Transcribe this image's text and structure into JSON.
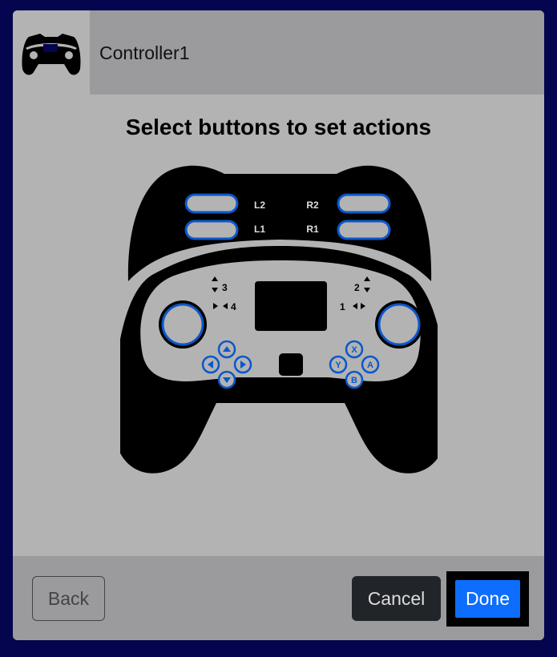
{
  "header": {
    "title": "Controller1",
    "icon": "gamepad-icon"
  },
  "instruction": "Select buttons to set actions",
  "controller": {
    "shoulder_labels": {
      "l2": "L2",
      "r2": "R2",
      "l1": "L1",
      "r1": "R1"
    },
    "axis_labels": {
      "left_vertical": "3",
      "left_horizontal": "4",
      "right_vertical": "2",
      "right_horizontal": "1"
    },
    "face_buttons": {
      "x": "X",
      "y": "Y",
      "a": "A",
      "b": "B"
    },
    "colors": {
      "body": "#000000",
      "panel": "#b3b3b3",
      "button_fill": "#b3b3b3",
      "button_stroke": "#0b57c9"
    }
  },
  "footer": {
    "back_label": "Back",
    "cancel_label": "Cancel",
    "done_label": "Done"
  }
}
